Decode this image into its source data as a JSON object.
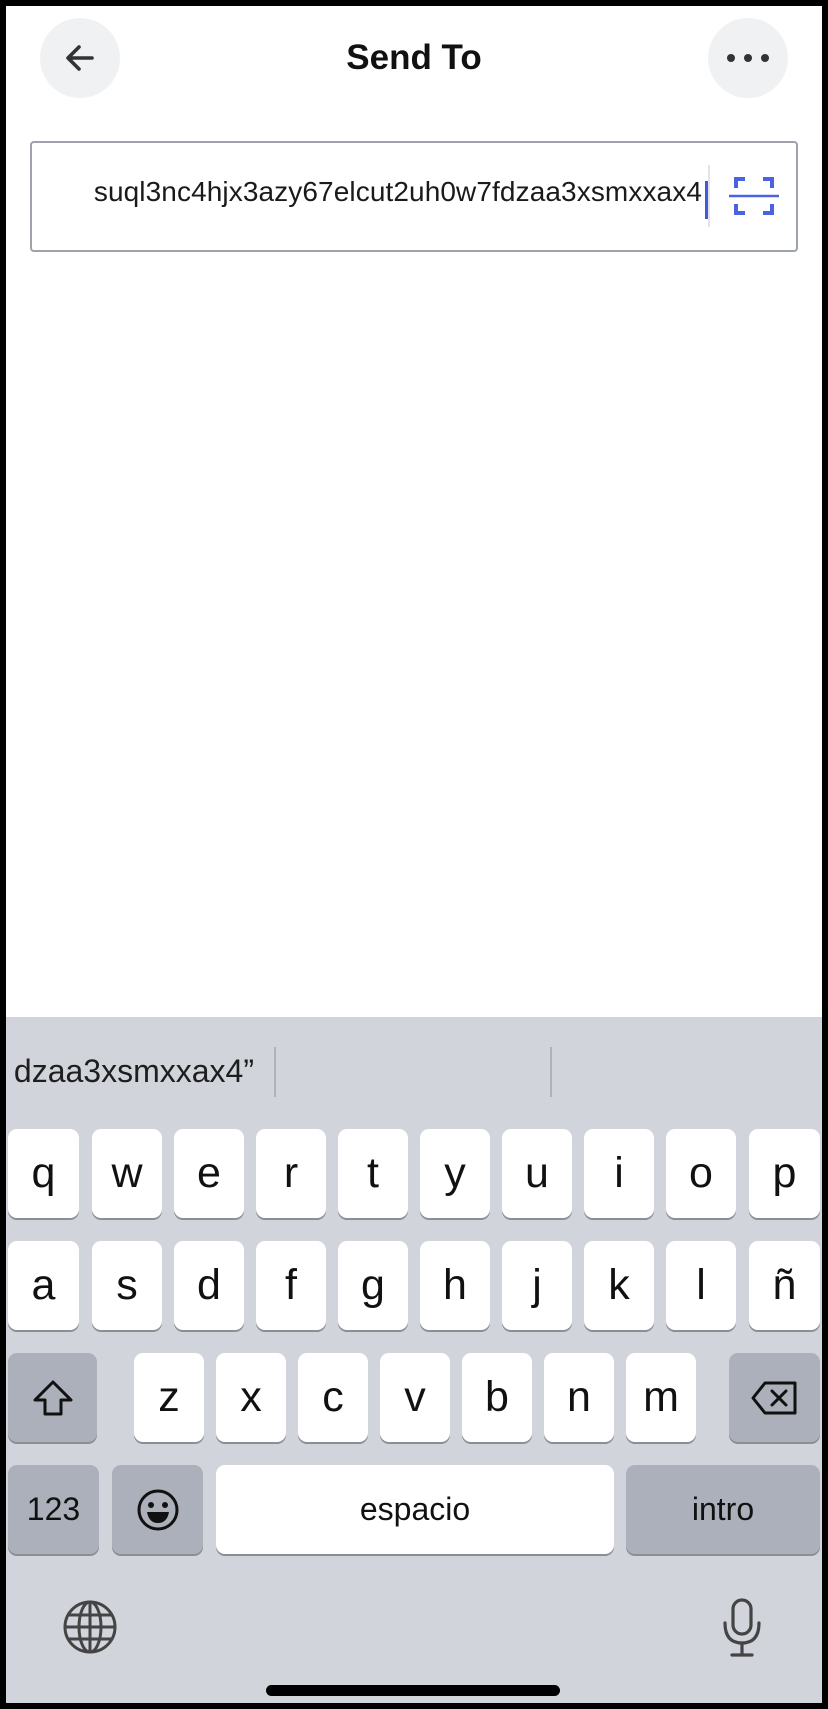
{
  "header": {
    "title": "Send To",
    "back_icon": "arrow-left-icon",
    "more_icon": "ellipsis-icon"
  },
  "address_input": {
    "value": "suql3nc4hjx3azy67elcut2uh0w7fdzaa3xsmxxax4",
    "scan_icon": "scan-qr-icon",
    "accent_color": "#3f5bdc"
  },
  "keyboard": {
    "suggestion": "dzaa3xsmxxax4”",
    "row1": [
      "q",
      "w",
      "e",
      "r",
      "t",
      "y",
      "u",
      "i",
      "o",
      "p"
    ],
    "row2": [
      "a",
      "s",
      "d",
      "f",
      "g",
      "h",
      "j",
      "k",
      "l",
      "ñ"
    ],
    "row3": [
      "z",
      "x",
      "c",
      "v",
      "b",
      "n",
      "m"
    ],
    "numbers_label": "123",
    "space_label": "espacio",
    "return_label": "intro",
    "icons": [
      "shift-icon",
      "backspace-icon",
      "emoji-icon",
      "globe-icon",
      "microphone-icon"
    ]
  }
}
